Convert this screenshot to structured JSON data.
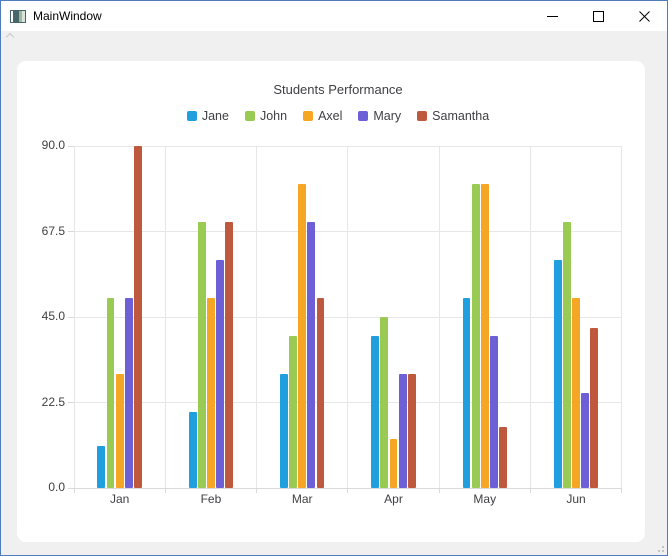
{
  "window": {
    "title": "MainWindow"
  },
  "colors": {
    "window_border": "#4f7cba",
    "background": "#f0f0f0",
    "panel": "#ffffff",
    "text": "#404044",
    "grid": "#e7e7e7"
  },
  "chart_data": {
    "type": "bar",
    "title": "Students Performance",
    "categories": [
      "Jan",
      "Feb",
      "Mar",
      "Apr",
      "May",
      "Jun"
    ],
    "series": [
      {
        "name": "Jane",
        "color": "#209fdf",
        "values": [
          11,
          20,
          30,
          40,
          50,
          60
        ]
      },
      {
        "name": "John",
        "color": "#99ca53",
        "values": [
          50,
          70,
          40,
          45,
          80,
          70
        ]
      },
      {
        "name": "Axel",
        "color": "#f6a625",
        "values": [
          30,
          50,
          80,
          13,
          80,
          50
        ]
      },
      {
        "name": "Mary",
        "color": "#6d5fd5",
        "values": [
          50,
          60,
          70,
          30,
          40,
          25
        ]
      },
      {
        "name": "Samantha",
        "color": "#bf593e",
        "values": [
          90,
          70,
          50,
          30,
          16,
          42
        ]
      }
    ],
    "xlabel": "",
    "ylabel": "",
    "ylim": [
      0,
      90
    ],
    "ytick_values": [
      0,
      22.5,
      45,
      67.5,
      90
    ],
    "yticks": [
      "0.0",
      "22.5",
      "45.0",
      "67.5",
      "90.0"
    ],
    "grid": true,
    "legend_position": "top",
    "bar_group_width_ratio": 0.5
  }
}
